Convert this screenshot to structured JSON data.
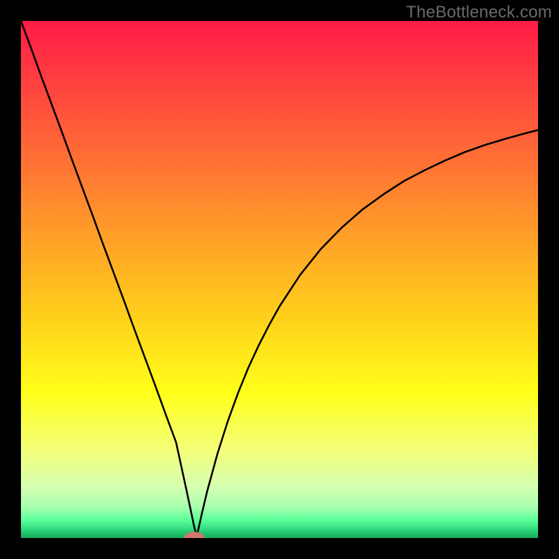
{
  "watermark": "TheBottleneck.com",
  "chart_data": {
    "type": "line",
    "title": "",
    "xlabel": "",
    "ylabel": "",
    "xlim": [
      0,
      100
    ],
    "ylim": [
      0,
      100
    ],
    "grid": false,
    "legend": false,
    "gradient_stops": [
      {
        "offset": 0.0,
        "color": "#ff1b47"
      },
      {
        "offset": 0.2,
        "color": "#ff5a3a"
      },
      {
        "offset": 0.4,
        "color": "#ff9a2a"
      },
      {
        "offset": 0.58,
        "color": "#ffd21a"
      },
      {
        "offset": 0.72,
        "color": "#ffff1a"
      },
      {
        "offset": 0.83,
        "color": "#f3ff7a"
      },
      {
        "offset": 0.9,
        "color": "#d6ffb0"
      },
      {
        "offset": 0.94,
        "color": "#a8ffb0"
      },
      {
        "offset": 0.965,
        "color": "#5cff9a"
      },
      {
        "offset": 0.985,
        "color": "#2bd57a"
      },
      {
        "offset": 1.0,
        "color": "#16a85a"
      }
    ],
    "series": [
      {
        "name": "bottleneck-curve",
        "x": [
          0,
          2,
          4,
          6,
          8,
          10,
          12,
          14,
          16,
          18,
          20,
          22,
          24,
          26,
          28,
          30,
          31,
          32,
          33,
          33.5,
          34,
          35,
          36,
          38,
          40,
          42,
          44,
          46,
          48,
          50,
          54,
          58,
          62,
          66,
          70,
          74,
          78,
          82,
          86,
          90,
          94,
          98,
          100
        ],
        "values": [
          100,
          94.6,
          89.1,
          83.7,
          78.3,
          72.8,
          67.4,
          62.0,
          56.5,
          51.1,
          45.7,
          40.2,
          34.8,
          29.4,
          23.9,
          18.5,
          13.9,
          9.3,
          4.6,
          2.2,
          0.3,
          4.8,
          9.0,
          16.3,
          22.6,
          28.1,
          33.0,
          37.3,
          41.2,
          44.8,
          50.9,
          55.9,
          60.0,
          63.5,
          66.4,
          69.0,
          71.1,
          73.0,
          74.7,
          76.1,
          77.3,
          78.4,
          78.9
        ]
      }
    ],
    "marker": {
      "x": 33.5,
      "y": 0.0,
      "color": "#d2776f",
      "rx": 2.0,
      "ry": 1.2
    }
  }
}
